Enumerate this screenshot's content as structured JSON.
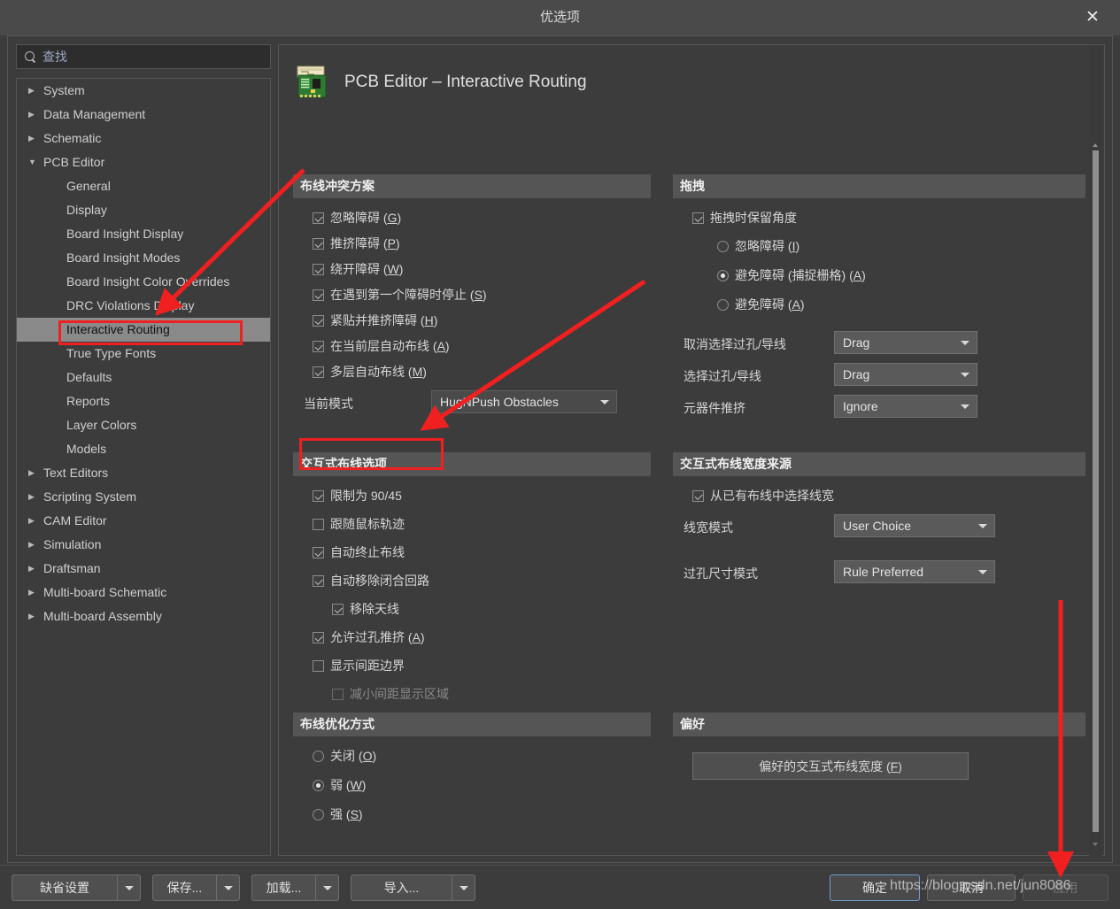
{
  "window": {
    "title": "优选项",
    "close_icon": "close-icon"
  },
  "search": {
    "placeholder": "查找",
    "value": "查找",
    "icon": "search-icon"
  },
  "sidebar": {
    "items": [
      {
        "label": "System",
        "level": 0,
        "expanded": false,
        "selected": false
      },
      {
        "label": "Data Management",
        "level": 0,
        "expanded": false,
        "selected": false
      },
      {
        "label": "Schematic",
        "level": 0,
        "expanded": false,
        "selected": false
      },
      {
        "label": "PCB Editor",
        "level": 0,
        "expanded": true,
        "selected": false
      },
      {
        "label": "General",
        "level": 1,
        "expanded": false,
        "selected": false
      },
      {
        "label": "Display",
        "level": 1,
        "expanded": false,
        "selected": false
      },
      {
        "label": "Board Insight Display",
        "level": 1,
        "expanded": false,
        "selected": false
      },
      {
        "label": "Board Insight Modes",
        "level": 1,
        "expanded": false,
        "selected": false
      },
      {
        "label": "Board Insight Color Overrides",
        "level": 1,
        "expanded": false,
        "selected": false
      },
      {
        "label": "DRC Violations Display",
        "level": 1,
        "expanded": false,
        "selected": false
      },
      {
        "label": "Interactive Routing",
        "level": 1,
        "expanded": false,
        "selected": true
      },
      {
        "label": "True Type Fonts",
        "level": 1,
        "expanded": false,
        "selected": false
      },
      {
        "label": "Defaults",
        "level": 1,
        "expanded": false,
        "selected": false
      },
      {
        "label": "Reports",
        "level": 1,
        "expanded": false,
        "selected": false
      },
      {
        "label": "Layer Colors",
        "level": 1,
        "expanded": false,
        "selected": false
      },
      {
        "label": "Models",
        "level": 1,
        "expanded": false,
        "selected": false
      },
      {
        "label": "Text Editors",
        "level": 0,
        "expanded": false,
        "selected": false
      },
      {
        "label": "Scripting System",
        "level": 0,
        "expanded": false,
        "selected": false
      },
      {
        "label": "CAM Editor",
        "level": 0,
        "expanded": false,
        "selected": false
      },
      {
        "label": "Simulation",
        "level": 0,
        "expanded": false,
        "selected": false
      },
      {
        "label": "Draftsman",
        "level": 0,
        "expanded": false,
        "selected": false
      },
      {
        "label": "Multi-board Schematic",
        "level": 0,
        "expanded": false,
        "selected": false
      },
      {
        "label": "Multi-board Assembly",
        "level": 0,
        "expanded": false,
        "selected": false
      }
    ]
  },
  "page": {
    "title": "PCB Editor – Interactive Routing",
    "icon": "pcb-board-icon"
  },
  "groups": {
    "routing_conflict": {
      "title": "布线冲突方案",
      "checkboxes": [
        {
          "label": "忽略障碍",
          "accel": "G",
          "checked": true
        },
        {
          "label": "推挤障碍",
          "accel": "P",
          "checked": true
        },
        {
          "label": "绕开障碍",
          "accel": "W",
          "checked": true
        },
        {
          "label": "在遇到第一个障碍时停止",
          "accel": "S",
          "checked": true
        },
        {
          "label": "紧贴并推挤障碍",
          "accel": "H",
          "checked": true
        },
        {
          "label": "在当前层自动布线",
          "accel": "A",
          "checked": true
        },
        {
          "label": "多层自动布线",
          "accel": "M",
          "checked": true
        }
      ],
      "current_mode_label": "当前模式",
      "current_mode_value": "HugNPush Obstacles"
    },
    "interactive_routing_options": {
      "title": "交互式布线选项",
      "items": [
        {
          "label": "限制为 90/45",
          "accel": "",
          "checked": true,
          "indent": 0,
          "disabled": false,
          "highlighted": true
        },
        {
          "label": "跟随鼠标轨迹",
          "accel": "",
          "checked": false,
          "indent": 0,
          "disabled": false,
          "highlighted": false
        },
        {
          "label": "自动终止布线",
          "accel": "",
          "checked": true,
          "indent": 0,
          "disabled": false,
          "highlighted": false
        },
        {
          "label": "自动移除闭合回路",
          "accel": "",
          "checked": true,
          "indent": 0,
          "disabled": false,
          "highlighted": false
        },
        {
          "label": "移除天线",
          "accel": "",
          "checked": true,
          "indent": 1,
          "disabled": false,
          "highlighted": false
        },
        {
          "label": "允许过孔推挤",
          "accel": "A",
          "checked": true,
          "indent": 0,
          "disabled": false,
          "highlighted": false
        },
        {
          "label": "显示间距边界",
          "accel": "",
          "checked": false,
          "indent": 0,
          "disabled": false,
          "highlighted": false
        },
        {
          "label": "减小间距显示区域",
          "accel": "",
          "checked": false,
          "indent": 1,
          "disabled": true,
          "highlighted": false
        }
      ]
    },
    "routing_optimization": {
      "title": "布线优化方式",
      "radios": [
        {
          "label": "关闭",
          "accel": "O",
          "selected": false
        },
        {
          "label": "弱",
          "accel": "W",
          "selected": true
        },
        {
          "label": "强",
          "accel": "S",
          "selected": false
        }
      ]
    },
    "drag": {
      "title": "拖拽",
      "preserve_angle": {
        "label": "拖拽时保留角度",
        "checked": true
      },
      "radios": [
        {
          "label": "忽略障碍",
          "accel": "I",
          "selected": false
        },
        {
          "label": "避免障碍 (捕捉栅格)",
          "accel": "A",
          "selected": true
        },
        {
          "label": "避免障碍",
          "accel": "A",
          "selected": false
        }
      ],
      "fields": [
        {
          "label": "取消选择过孔/导线",
          "value": "Drag"
        },
        {
          "label": "选择过孔/导线",
          "value": "Drag"
        },
        {
          "label": "元器件推挤",
          "value": "Ignore"
        }
      ]
    },
    "width_source": {
      "title": "交互式布线宽度来源",
      "checkbox": {
        "label": "从已有布线中选择线宽",
        "checked": true
      },
      "fields": [
        {
          "label": "线宽模式",
          "value": "User Choice"
        },
        {
          "label": "过孔尺寸模式",
          "value": "Rule Preferred"
        }
      ]
    },
    "favorites": {
      "title": "偏好",
      "button": {
        "label": "偏好的交互式布线宽度",
        "accel": "F"
      }
    }
  },
  "bottom_bar": {
    "split_buttons": [
      {
        "label": "缺省设置"
      },
      {
        "label": "保存..."
      },
      {
        "label": "加载..."
      },
      {
        "label": "导入..."
      }
    ],
    "ok_label": "确定",
    "cancel_label": "取消",
    "apply_label": "应用"
  },
  "watermark": {
    "text": "https://blog.csdn.net/jun8086"
  },
  "annotation": {
    "color": "#f02020"
  }
}
